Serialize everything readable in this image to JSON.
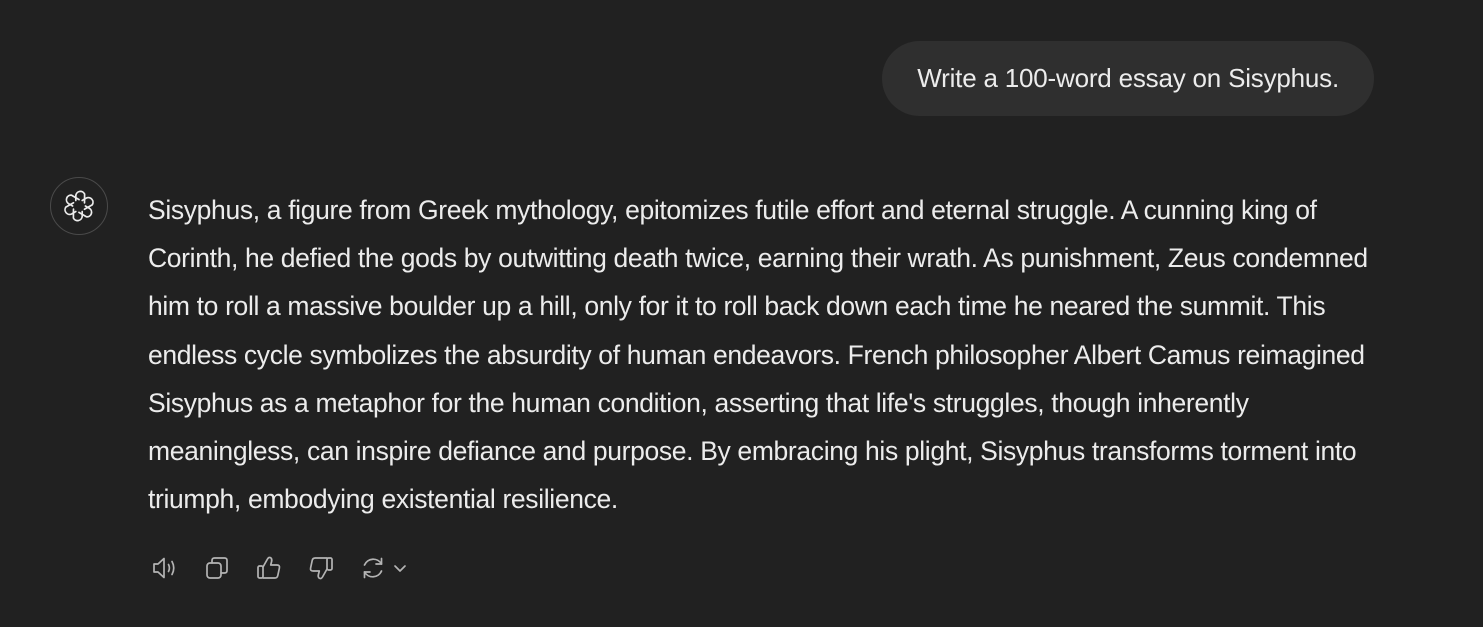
{
  "conversation": {
    "user_message": "Write a 100-word essay on Sisyphus.",
    "assistant": {
      "avatar_icon": "openai-logo-icon",
      "response": "Sisyphus, a figure from Greek mythology, epitomizes futile effort and eternal struggle. A cunning king of Corinth, he defied the gods by outwitting death twice, earning their wrath. As punishment, Zeus condemned him to roll a massive boulder up a hill, only for it to roll back down each time he neared the summit. This endless cycle symbolizes the absurdity of human endeavors. French philosopher Albert Camus reimagined Sisyphus as a metaphor for the human condition, asserting that life's struggles, though inherently meaningless, can inspire defiance and purpose. By embracing his plight, Sisyphus transforms torment into triumph, embodying existential resilience."
    }
  },
  "actions": [
    {
      "id": "read-aloud",
      "icon": "speaker-icon"
    },
    {
      "id": "copy",
      "icon": "copy-icon"
    },
    {
      "id": "good-response",
      "icon": "thumbs-up-icon"
    },
    {
      "id": "bad-response",
      "icon": "thumbs-down-icon"
    },
    {
      "id": "regenerate",
      "icon": "regenerate-icon"
    }
  ],
  "colors": {
    "background": "#212121",
    "user_bubble": "#2f2f2f",
    "text": "#ececec",
    "icon": "#b4b4b4"
  }
}
